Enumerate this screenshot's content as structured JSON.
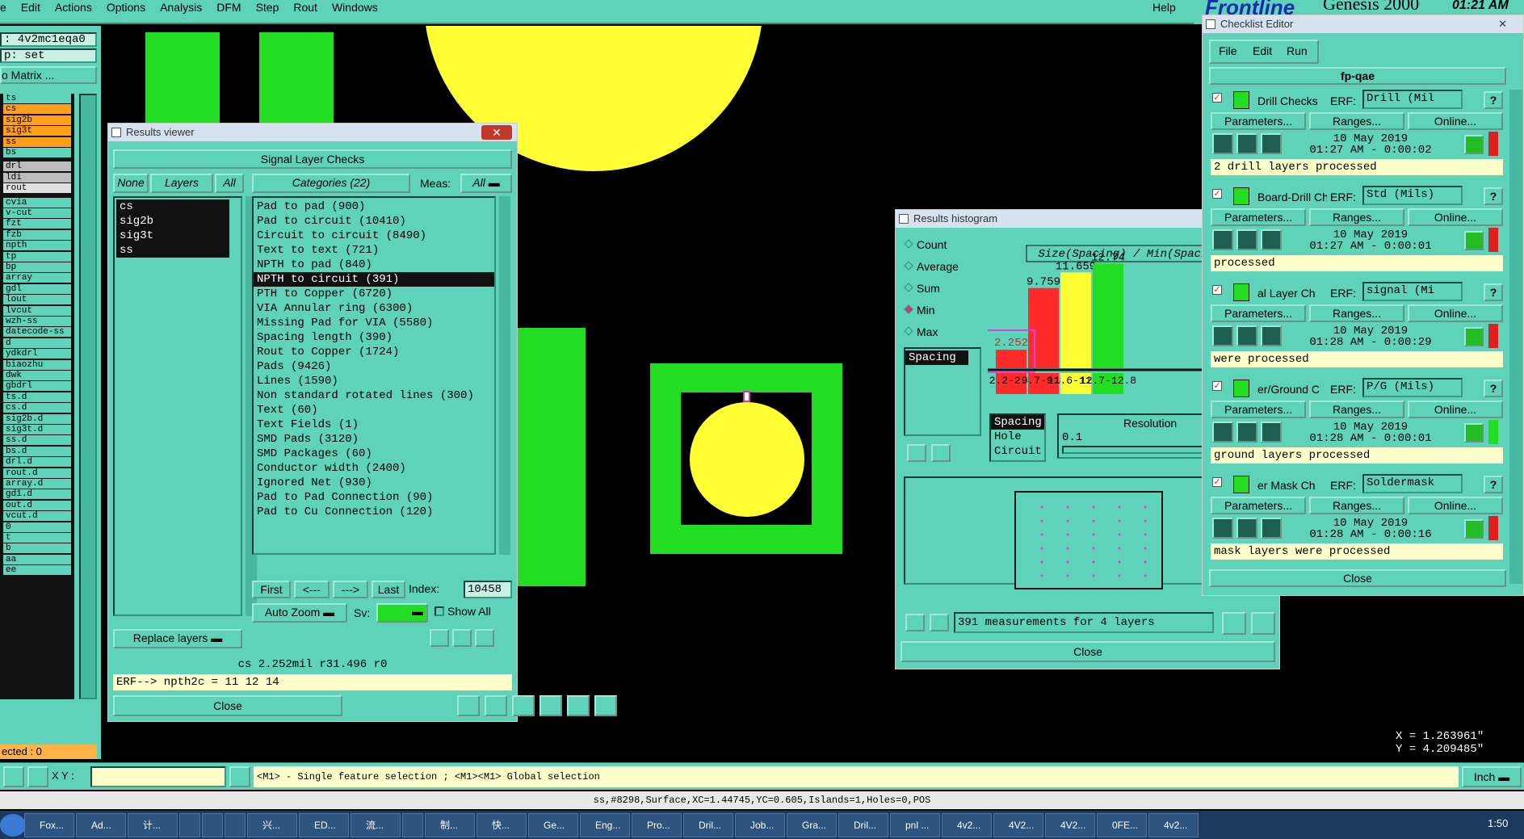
{
  "menubar": {
    "items": [
      "e",
      "Edit",
      "Actions",
      "Options",
      "Analysis",
      "DFM",
      "Step",
      "Rout",
      "Windows"
    ],
    "help": "Help",
    "brand": "Frontline",
    "product": "Genesis 2000",
    "clock": "01:21 AM"
  },
  "left": {
    "job": ": 4v2mc1eqa0",
    "step": "p: set",
    "matrix": "o Matrix ...",
    "layers": [
      {
        "n": "ts",
        "c": "#5fd3b9"
      },
      {
        "n": "cs",
        "c": "#ff9f1a"
      },
      {
        "n": "sig2b",
        "c": "#ff9f1a"
      },
      {
        "n": "sig3t",
        "c": "#ff9f1a"
      },
      {
        "n": "ss",
        "c": "#ff9f1a"
      },
      {
        "n": "bs",
        "c": "#5fd3b9"
      },
      {
        "n": "drl",
        "c": "#bdbdbd"
      },
      {
        "n": "ldi",
        "c": "#bdbdbd"
      },
      {
        "n": "rout",
        "c": "#e0e0e0"
      },
      {
        "n": "cvia",
        "c": "#5fd3b9"
      },
      {
        "n": "v-cut",
        "c": "#5fd3b9"
      },
      {
        "n": "fzt",
        "c": "#5fd3b9"
      },
      {
        "n": "fzb",
        "c": "#5fd3b9"
      },
      {
        "n": "npth",
        "c": "#5fd3b9"
      },
      {
        "n": "tp",
        "c": "#5fd3b9"
      },
      {
        "n": "bp",
        "c": "#5fd3b9"
      },
      {
        "n": "array",
        "c": "#5fd3b9"
      },
      {
        "n": "gdl",
        "c": "#5fd3b9"
      },
      {
        "n": "lout",
        "c": "#5fd3b9"
      },
      {
        "n": "lvcut",
        "c": "#5fd3b9"
      },
      {
        "n": "wzh-ss",
        "c": "#5fd3b9"
      },
      {
        "n": "datecode-ss",
        "c": "#5fd3b9"
      },
      {
        "n": "d",
        "c": "#5fd3b9"
      },
      {
        "n": "ydkdrl",
        "c": "#5fd3b9"
      },
      {
        "n": "biaozhu",
        "c": "#5fd3b9"
      },
      {
        "n": "dwk",
        "c": "#5fd3b9"
      },
      {
        "n": "gbdrl",
        "c": "#5fd3b9"
      },
      {
        "n": "ts.d",
        "c": "#5fd3b9"
      },
      {
        "n": "cs.d",
        "c": "#5fd3b9"
      },
      {
        "n": "sig2b.d",
        "c": "#5fd3b9"
      },
      {
        "n": "sig3t.d",
        "c": "#5fd3b9"
      },
      {
        "n": "ss.d",
        "c": "#5fd3b9"
      },
      {
        "n": "bs.d",
        "c": "#5fd3b9"
      },
      {
        "n": "drl.d",
        "c": "#5fd3b9"
      },
      {
        "n": "rout.d",
        "c": "#5fd3b9"
      },
      {
        "n": "array.d",
        "c": "#5fd3b9"
      },
      {
        "n": "gd1.d",
        "c": "#5fd3b9"
      },
      {
        "n": "out.d",
        "c": "#5fd3b9"
      },
      {
        "n": "vcut.d",
        "c": "#5fd3b9"
      },
      {
        "n": "0",
        "c": "#5fd3b9"
      },
      {
        "n": "t",
        "c": "#5fd3b9"
      },
      {
        "n": "b",
        "c": "#5fd3b9"
      },
      {
        "n": "aa",
        "c": "#5fd3b9"
      },
      {
        "n": "ee",
        "c": "#5fd3b9"
      }
    ],
    "selected": "ected : 0"
  },
  "results_viewer": {
    "title": "Results viewer",
    "heading": "Signal Layer Checks",
    "none": "None",
    "layers": "Layers",
    "all": "All",
    "categories_label": "Categories (22)",
    "meas_label": "Meas:",
    "meas_value": "All",
    "layer_list": [
      "cs",
      "sig2b",
      "sig3t",
      "ss"
    ],
    "categories": [
      "Pad to pad (900)",
      "Pad to circuit (10410)",
      "Circuit to circuit (8490)",
      "Text to text (721)",
      "NPTH to pad (840)",
      "NPTH to circuit (391)",
      "PTH to Copper (6720)",
      "VIA Annular ring (6300)",
      "Missing Pad for VIA (5580)",
      "Spacing length (390)",
      "Rout to Copper (1724)",
      "Pads (9426)",
      "Lines (1590)",
      "Non standard rotated lines (300)",
      "Text (60)",
      "Text Fields (1)",
      "SMD Pads (3120)",
      "SMD Packages (60)",
      "Conductor width (2400)",
      "Ignored Net (930)",
      "Pad to Pad Connection (90)",
      "Pad to Cu Connection (120)"
    ],
    "selected_index": 5,
    "first": "First",
    "prev": "<---",
    "next": "--->",
    "last": "Last",
    "index_label": "Index:",
    "index_value": "10458",
    "zoom": "Auto Zoom",
    "sv": "Sv:",
    "show_all": "Show All",
    "replace": "Replace layers",
    "info": "cs 2.252mil  r31.496  r0",
    "erf": "ERF--> npth2c = 11 12 14",
    "close": "Close"
  },
  "histogram": {
    "title": "Results histogram",
    "options": [
      "Count",
      "Average",
      "Sum",
      "Min",
      "Max"
    ],
    "selected_option": "Min",
    "chart_title": "Size(Spacing) / Min(Spacing)",
    "list_item": "Spacing",
    "bins": [
      {
        "label": "2.2-2.3",
        "value": 2.252,
        "color": "#ff2a2a"
      },
      {
        "label": "9.7-9.8",
        "value": 9.759,
        "color": "#ff2a2a"
      },
      {
        "label": "11.6-11.7",
        "value": 11.659,
        "color": "#ffff33"
      },
      {
        "label": "12.7-12.8",
        "value": 12.74,
        "color": "#22dd22"
      }
    ],
    "value_labels": [
      "2.252",
      "9.759",
      "11.659",
      "12.74"
    ],
    "bin_labels": [
      "2.2-2.3",
      "9.7-9.8",
      "11.6-11.7",
      "12.7-12.8"
    ],
    "types": [
      "Spacing",
      "Hole",
      "Circuit"
    ],
    "resolution_label": "Resolution",
    "resolution_value": "0.1",
    "summary": "391 measurements for 4 layers",
    "close": "Close"
  },
  "checklist": {
    "title": "Checklist Editor",
    "menu": [
      "File",
      "Edit",
      "Run"
    ],
    "name": "fp-qae",
    "checks": [
      {
        "name": "Drill Checks",
        "erf": "Drill (Mil",
        "date": "10 May 2019",
        "time": "01:27 AM - 0:00:02",
        "msg": "2 drill layers processed",
        "status": "#e02020"
      },
      {
        "name": "Board-Drill Che",
        "erf": "Std (Mils)",
        "date": "10 May 2019",
        "time": "01:27 AM - 0:00:01",
        "msg": "processed",
        "status": "#e02020"
      },
      {
        "name": "al Layer Ch",
        "erf": "signal (Mi",
        "date": "10 May 2019",
        "time": "01:28 AM - 0:00:29",
        "msg": "were processed",
        "status": "#e02020"
      },
      {
        "name": "er/Ground C",
        "erf": "P/G (Mils)",
        "date": "10 May 2019",
        "time": "01:28 AM - 0:00:01",
        "msg": "ground layers processed",
        "status": "#22dd22"
      },
      {
        "name": "er Mask Ch",
        "erf": "Soldermask",
        "date": "10 May 2019",
        "time": "01:28 AM - 0:00:16",
        "msg": "mask layers were processed",
        "status": "#e02020"
      }
    ],
    "erf_label": "ERF:",
    "params": "Parameters...",
    "ranges": "Ranges...",
    "online": "Online...",
    "close": "Close"
  },
  "coords": {
    "x": "X = 1.263961\"",
    "y": "Y = 4.209485\""
  },
  "bottom": {
    "xy_label": "X Y :",
    "hint": "<M1> - Single feature selection ; <M1><M1> Global selection",
    "units": "Inch",
    "status": "ss,#8298,Surface,XC=1.44745,YC=0.605,Islands=1,Holes=0,POS"
  },
  "taskbar": {
    "items": [
      "Fox...",
      "Ad...",
      "计...",
      "",
      "",
      "",
      "兴...",
      "ED...",
      "流...",
      "",
      "制...",
      "快...",
      "Ge...",
      "Eng...",
      "Pro...",
      "Dril...",
      "Job...",
      "Gra...",
      "Dril...",
      "pnl ...",
      "4v2...",
      "4V2...",
      "4V2...",
      "0FE...",
      "4v2..."
    ],
    "clock": "1:50"
  }
}
